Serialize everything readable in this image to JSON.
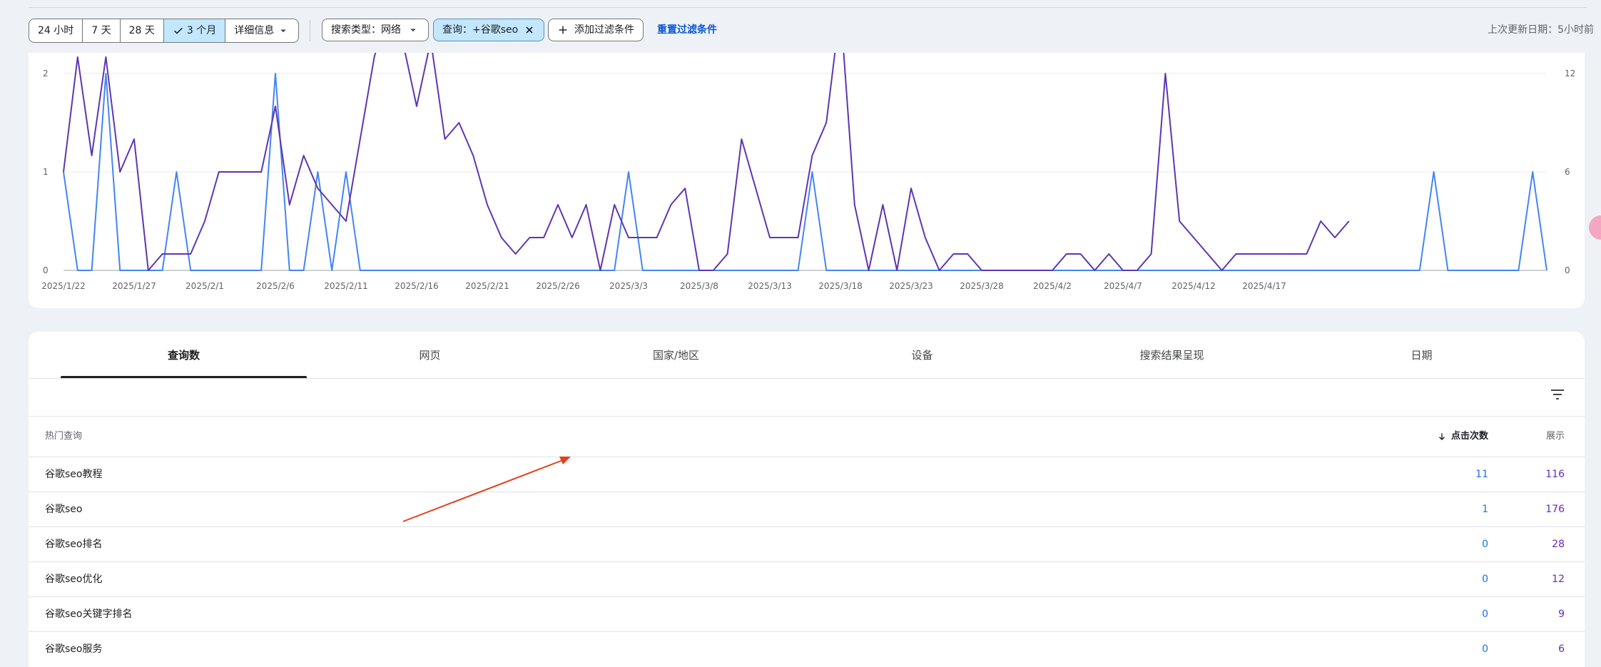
{
  "filter_bar": {
    "ranges": [
      {
        "label": "24 小时",
        "selected": false
      },
      {
        "label": "7 天",
        "selected": false
      },
      {
        "label": "28 天",
        "selected": false
      },
      {
        "label": "3 个月",
        "selected": true
      },
      {
        "label": "详细信息",
        "selected": false
      }
    ],
    "search_type": "搜索类型：网络",
    "query_filter": "查询：+谷歌seo",
    "add_filter": "添加过滤条件",
    "reset": "重置过滤条件",
    "last_updated": "上次更新日期：5小时前"
  },
  "chart_data": {
    "type": "line",
    "x_tick_labels": [
      "2025/1/22",
      "2025/1/27",
      "2025/2/1",
      "2025/2/6",
      "2025/2/11",
      "2025/2/16",
      "2025/2/21",
      "2025/2/26",
      "2025/3/3",
      "2025/3/8",
      "2025/3/13",
      "2025/3/18",
      "2025/3/23",
      "2025/3/28",
      "2025/4/2",
      "2025/4/7",
      "2025/4/12",
      "2025/4/17"
    ],
    "y_left": {
      "ticks": [
        "0",
        "1",
        "2"
      ],
      "range": [
        0,
        2.5
      ]
    },
    "y_right": {
      "ticks": [
        "0",
        "6",
        "12"
      ],
      "range": [
        0,
        15
      ]
    },
    "grid": true,
    "series": [
      {
        "key": "clicks",
        "axis": "left",
        "color": "#4285f4",
        "values": [
          1,
          0,
          0,
          2,
          0,
          0,
          0,
          0,
          1,
          0,
          0,
          0,
          0,
          0,
          0,
          2,
          0,
          0,
          1,
          0,
          1,
          0,
          0,
          0,
          0,
          0,
          0,
          0,
          0,
          0,
          0,
          0,
          0,
          0,
          0,
          0,
          0,
          0,
          0,
          0,
          1,
          0,
          0,
          0,
          0,
          0,
          0,
          0,
          0,
          0,
          0,
          0,
          0,
          1,
          0,
          0,
          0,
          0,
          0,
          0,
          0,
          0,
          0,
          0,
          0,
          0,
          0,
          0,
          0,
          0,
          0,
          0,
          0,
          0,
          0,
          0,
          0,
          0,
          0,
          0,
          0,
          0,
          0,
          0,
          0,
          0,
          0,
          0,
          0,
          0,
          0,
          0,
          0,
          0,
          0,
          0,
          0,
          1,
          0,
          0,
          0,
          0,
          0,
          0,
          1,
          0
        ]
      },
      {
        "key": "impressions",
        "axis": "right",
        "color": "#5e35b1",
        "values": [
          6,
          13,
          7,
          13,
          6,
          8,
          0,
          1,
          1,
          1,
          3,
          6,
          6,
          6,
          6,
          10,
          4,
          7,
          5,
          4,
          3,
          8,
          13,
          16,
          14,
          10,
          14,
          8,
          9,
          7,
          4,
          2,
          1,
          2,
          2,
          4,
          2,
          4,
          0,
          4,
          2,
          2,
          2,
          4,
          5,
          0,
          0,
          1,
          8,
          5,
          2,
          2,
          2,
          7,
          9,
          16,
          4,
          0,
          4,
          0,
          5,
          2,
          0,
          1,
          1,
          0,
          0,
          0,
          0,
          0,
          0,
          1,
          1,
          0,
          1,
          0,
          0,
          1,
          12,
          3,
          2,
          1,
          0,
          1,
          1,
          1,
          1,
          1,
          1,
          3,
          2,
          3
        ]
      }
    ]
  },
  "tabs": [
    {
      "label": "查询数",
      "active": true
    },
    {
      "label": "网页",
      "active": false
    },
    {
      "label": "国家/地区",
      "active": false
    },
    {
      "label": "设备",
      "active": false
    },
    {
      "label": "搜索结果呈现",
      "active": false
    },
    {
      "label": "日期",
      "active": false
    }
  ],
  "table": {
    "col_query": "热门查询",
    "col_clicks": "点击次数",
    "col_impressions": "展示",
    "rows": [
      {
        "query": "谷歌seo教程",
        "clicks": "11",
        "impressions": "116"
      },
      {
        "query": "谷歌seo",
        "clicks": "1",
        "impressions": "176"
      },
      {
        "query": "谷歌seo排名",
        "clicks": "0",
        "impressions": "28"
      },
      {
        "query": "谷歌seo优化",
        "clicks": "0",
        "impressions": "12"
      },
      {
        "query": "谷歌seo关键字排名",
        "clicks": "0",
        "impressions": "9"
      },
      {
        "query": "谷歌seo服务",
        "clicks": "0",
        "impressions": "6"
      }
    ]
  },
  "annotation": {
    "color": "#e0421b"
  }
}
